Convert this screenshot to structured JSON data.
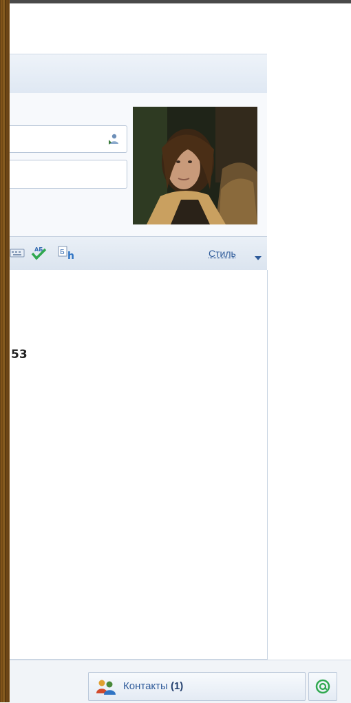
{
  "toolbar": {
    "style_label": "Стиль",
    "icons": [
      "keyboard-icon",
      "spellcheck-icon",
      "translate-icon",
      "style-dropdown-icon"
    ]
  },
  "compose": {
    "to_value": "",
    "subject_value": "",
    "body_fragment": "53"
  },
  "statusbar": {
    "contacts_label": "Контакты",
    "contacts_count": "(1)"
  },
  "colors": {
    "accent_link": "#2f5b9a",
    "toolbar_bg": "#dfe8f3",
    "status_green": "#2fa84f"
  }
}
